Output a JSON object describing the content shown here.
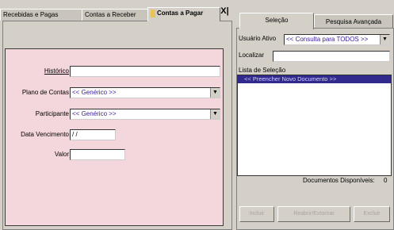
{
  "left_tabs": {
    "items": [
      {
        "label": "Recebidas e Pagas"
      },
      {
        "label": "Contas a Receber"
      },
      {
        "label": "Contas a Pagar"
      }
    ],
    "close_label": "X|"
  },
  "form": {
    "historico": {
      "label": "Histórico",
      "value": ""
    },
    "plano_de_contas": {
      "label": "Plano de Contas",
      "value": "<< Genérico >>"
    },
    "participante": {
      "label": "Participante",
      "value": "<< Genérico >>"
    },
    "data_vencimento": {
      "label": "Data Vencimento",
      "value": " / /"
    },
    "valor": {
      "label": "Valor",
      "value": ""
    }
  },
  "right_tabs": {
    "items": [
      {
        "label": "Seleção"
      },
      {
        "label": "Pesquisa Avançada"
      }
    ]
  },
  "selection": {
    "usuario_ativo_label": "Usuário Ativo",
    "usuario_ativo_value": "<< Consulta para TODOS >>",
    "localizar_label": "Localizar",
    "localizar_value": "",
    "lista_label": "Lista de Seleção",
    "list_items": [
      "<< Preencher Novo Documento >>"
    ],
    "documentos_label": "Documentos Disponíveis:",
    "documentos_count": "0"
  },
  "buttons": {
    "incluir": "Incluir",
    "reabrir": "Reabrir/Extornar",
    "excluir": "Excluir"
  },
  "colors": {
    "form_background": "#f4d7dc",
    "selection_highlight": "#2f2a8c",
    "window_face": "#d4d0c8"
  }
}
